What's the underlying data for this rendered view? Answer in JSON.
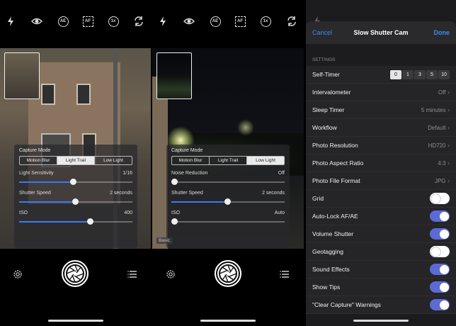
{
  "camera_left": {
    "panel": {
      "capture_mode_label": "Capture Mode",
      "modes": [
        "Motion Blur",
        "Light Trail",
        "Low Light"
      ],
      "selected_mode": "Light Trail",
      "sliders": [
        {
          "label": "Light Sensitivity",
          "value": "1/16",
          "level": 0.45
        },
        {
          "label": "Shutter Speed",
          "value": "2 seconds",
          "level": 0.47
        },
        {
          "label": "ISO",
          "value": "400",
          "level": 0.6
        }
      ]
    }
  },
  "camera_right": {
    "panel": {
      "capture_mode_label": "Capture Mode",
      "modes": [
        "Motion Blur",
        "Light Trail",
        "Low Light"
      ],
      "selected_mode": "Low Light",
      "sliders": [
        {
          "label": "Noise Reduction",
          "value": "Off",
          "level": 0.0
        },
        {
          "label": "Shutter Speed",
          "value": "2 seconds",
          "level": 0.47
        },
        {
          "label": "ISO",
          "value": "Auto",
          "level": 0.0
        }
      ]
    },
    "basic_label": "Basic"
  },
  "top_icons": [
    "flash-icon",
    "eye-icon",
    "ae-icon",
    "af-icon",
    "zoom-1x-icon",
    "switch-camera-icon"
  ],
  "top_icon_text": {
    "ae": "AE",
    "af": "AF",
    "zoom": "1x"
  },
  "settings": {
    "cancel": "Cancel",
    "title": "Slow Shutter Cam",
    "done": "Done",
    "section": "SETTINGS",
    "self_timer": {
      "label": "Self-Timer",
      "options": [
        "0",
        "1",
        "3",
        "5",
        "10"
      ],
      "selected": "0"
    },
    "rows": [
      {
        "label": "Intervalometer",
        "value": "Off"
      },
      {
        "label": "Sleep Timer",
        "value": "5 minutes"
      },
      {
        "label": "Workflow",
        "value": "Default"
      },
      {
        "label": "Photo Resolution",
        "value": "HD720"
      },
      {
        "label": "Photo Aspect Ratio",
        "value": "4:3"
      },
      {
        "label": "Photo File Format",
        "value": "JPG"
      }
    ],
    "toggles": [
      {
        "label": "Grid",
        "on": false
      },
      {
        "label": "Auto-Lock AF/AE",
        "on": true
      },
      {
        "label": "Volume Shutter",
        "on": true
      },
      {
        "label": "Geotagging",
        "on": false
      },
      {
        "label": "Sound Effects",
        "on": true
      },
      {
        "label": "Show Tips",
        "on": true
      },
      {
        "label": "\"Clear Capture\" Warnings",
        "on": true
      }
    ]
  },
  "colors": {
    "accent": "#3a8bf7",
    "toggle_on": "#5b6bd6",
    "slider_fill": "#3a7bf6"
  }
}
